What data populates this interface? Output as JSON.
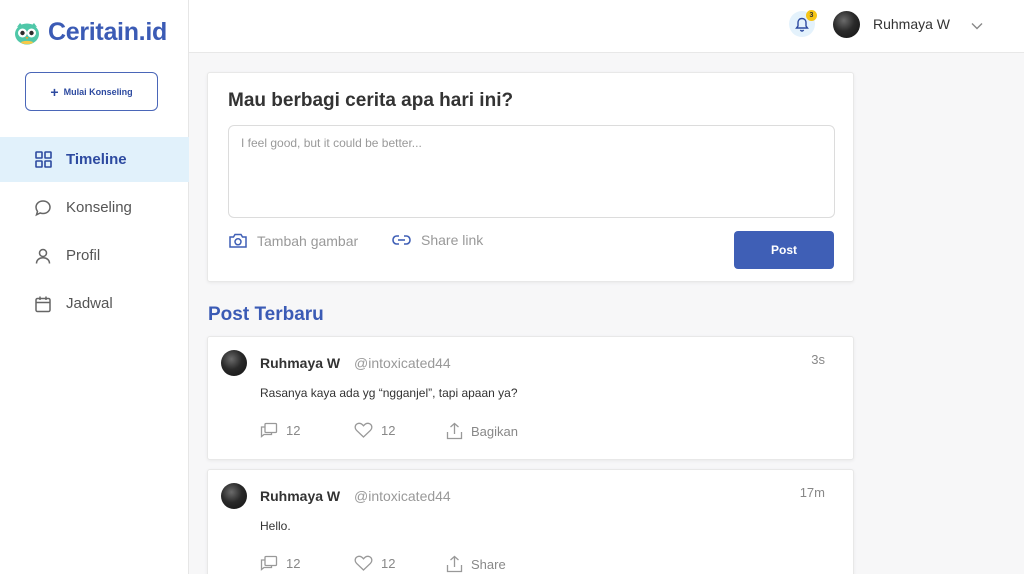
{
  "app": {
    "name": "Ceritain.id"
  },
  "sidebar": {
    "new_button": "Mulai Konseling",
    "items": [
      {
        "label": "Timeline",
        "icon": "grid-icon",
        "active": true
      },
      {
        "label": "Konseling",
        "icon": "chat-bubble-icon",
        "active": false
      },
      {
        "label": "Profil",
        "icon": "user-icon",
        "active": false
      },
      {
        "label": "Jadwal",
        "icon": "calendar-icon",
        "active": false
      }
    ]
  },
  "header": {
    "notification_count": "3",
    "user_name": "Ruhmaya W"
  },
  "compose": {
    "title": "Mau berbagi cerita apa hari ini?",
    "placeholder": "I feel good, but it could be better...",
    "add_image": "Tambah gambar",
    "share_link": "Share link",
    "post_button": "Post"
  },
  "feed": {
    "title": "Post Terbaru",
    "posts": [
      {
        "name": "Ruhmaya W",
        "handle": "@intoxicated44",
        "time": "3s",
        "body": "Rasanya kaya ada yg “ngganjel”, tapi apaan ya?",
        "replies": "12",
        "likes": "12",
        "share_label": "Bagikan"
      },
      {
        "name": "Ruhmaya W",
        "handle": "@intoxicated44",
        "time": "17m",
        "body": "Hello.",
        "replies": "12",
        "likes": "12",
        "share_label": "Share"
      }
    ]
  },
  "colors": {
    "brand": "#3b5bb5",
    "primary_button": "#3f5fb6",
    "active_nav_bg": "#e1f1fb",
    "badge": "#f5c518"
  }
}
